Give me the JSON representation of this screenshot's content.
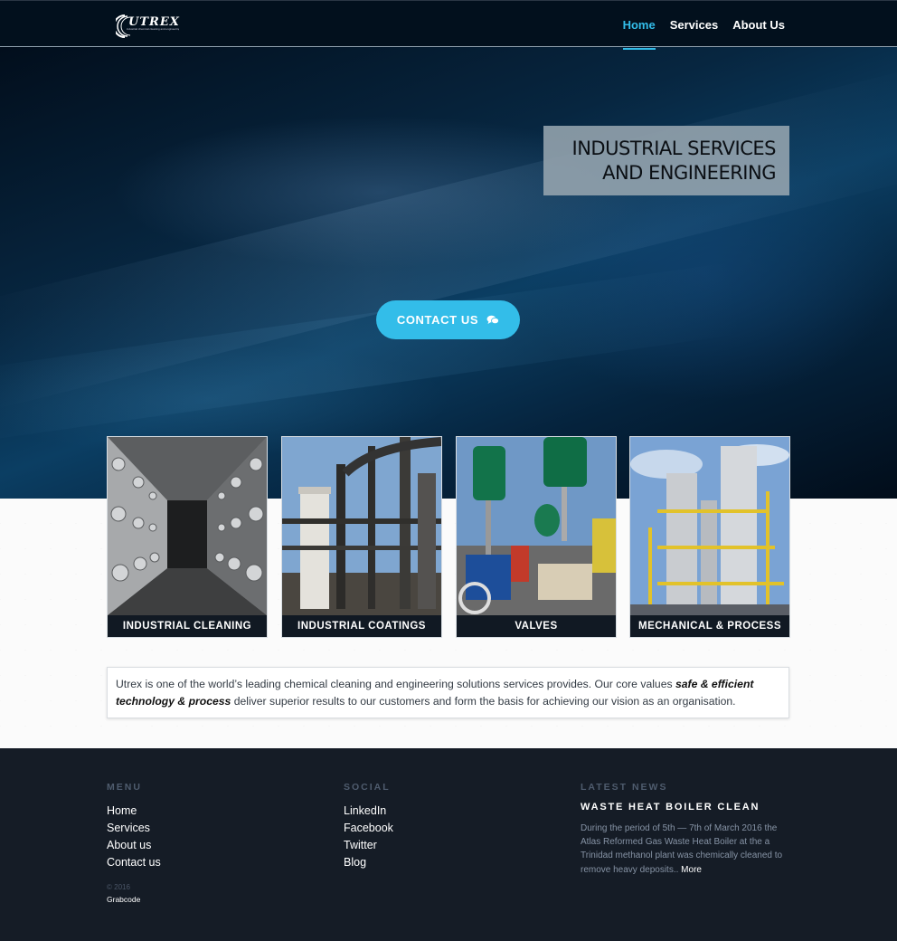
{
  "colors": {
    "accent": "#33bde9",
    "nav_bg": "#02101d",
    "footer_bg": "#151c26",
    "card_label_bg": "#111923",
    "headline_box_bg": "#96a5af"
  },
  "nav": {
    "logo_text": "UTREX",
    "logo_tagline": "industrial chemical cleaning and engineering",
    "links": [
      {
        "label": "Home",
        "active": true
      },
      {
        "label": "Services",
        "active": false
      },
      {
        "label": "About Us",
        "active": false
      }
    ]
  },
  "hero": {
    "headline_line1": "INDUSTRIAL SERVICES",
    "headline_line2": "AND ENGINEERING",
    "cta_label": "CONTACT US",
    "cta_icon": "chat-bubbles-icon"
  },
  "services": [
    {
      "label": "INDUSTRIAL CLEANING",
      "image": "duct-interior"
    },
    {
      "label": "INDUSTRIAL COATINGS",
      "image": "pipe-structure"
    },
    {
      "label": "VALVES",
      "image": "industrial-valves"
    },
    {
      "label": "MECHANICAL & PROCESS",
      "image": "process-plant"
    }
  ],
  "intro": {
    "text_before": "Utrex is one of the world’s leading chemical cleaning and engineering solutions services provides. Our core values ",
    "emphasis": "safe & efficient technology & process",
    "text_after": " deliver superior results to our customers and form the basis for achieving our vision as an organisation."
  },
  "footer": {
    "menu_heading": "MENU",
    "menu_links": [
      "Home",
      "Services",
      "About us",
      "Contact us"
    ],
    "social_heading": "SOCIAL",
    "social_links": [
      "LinkedIn",
      "Facebook",
      "Twitter",
      "Blog"
    ],
    "news_heading": "LATEST NEWS",
    "news_title": "WASTE HEAT BOILER CLEAN",
    "news_body": "During the period of 5th — 7th of March 2016 the Atlas Reformed Gas Waste Heat Boiler at the a Trinidad methanol plant was chemically cleaned to remove heavy deposits.. ",
    "news_more": "More",
    "copyright": "© 2016",
    "credit": "Grabcode"
  }
}
